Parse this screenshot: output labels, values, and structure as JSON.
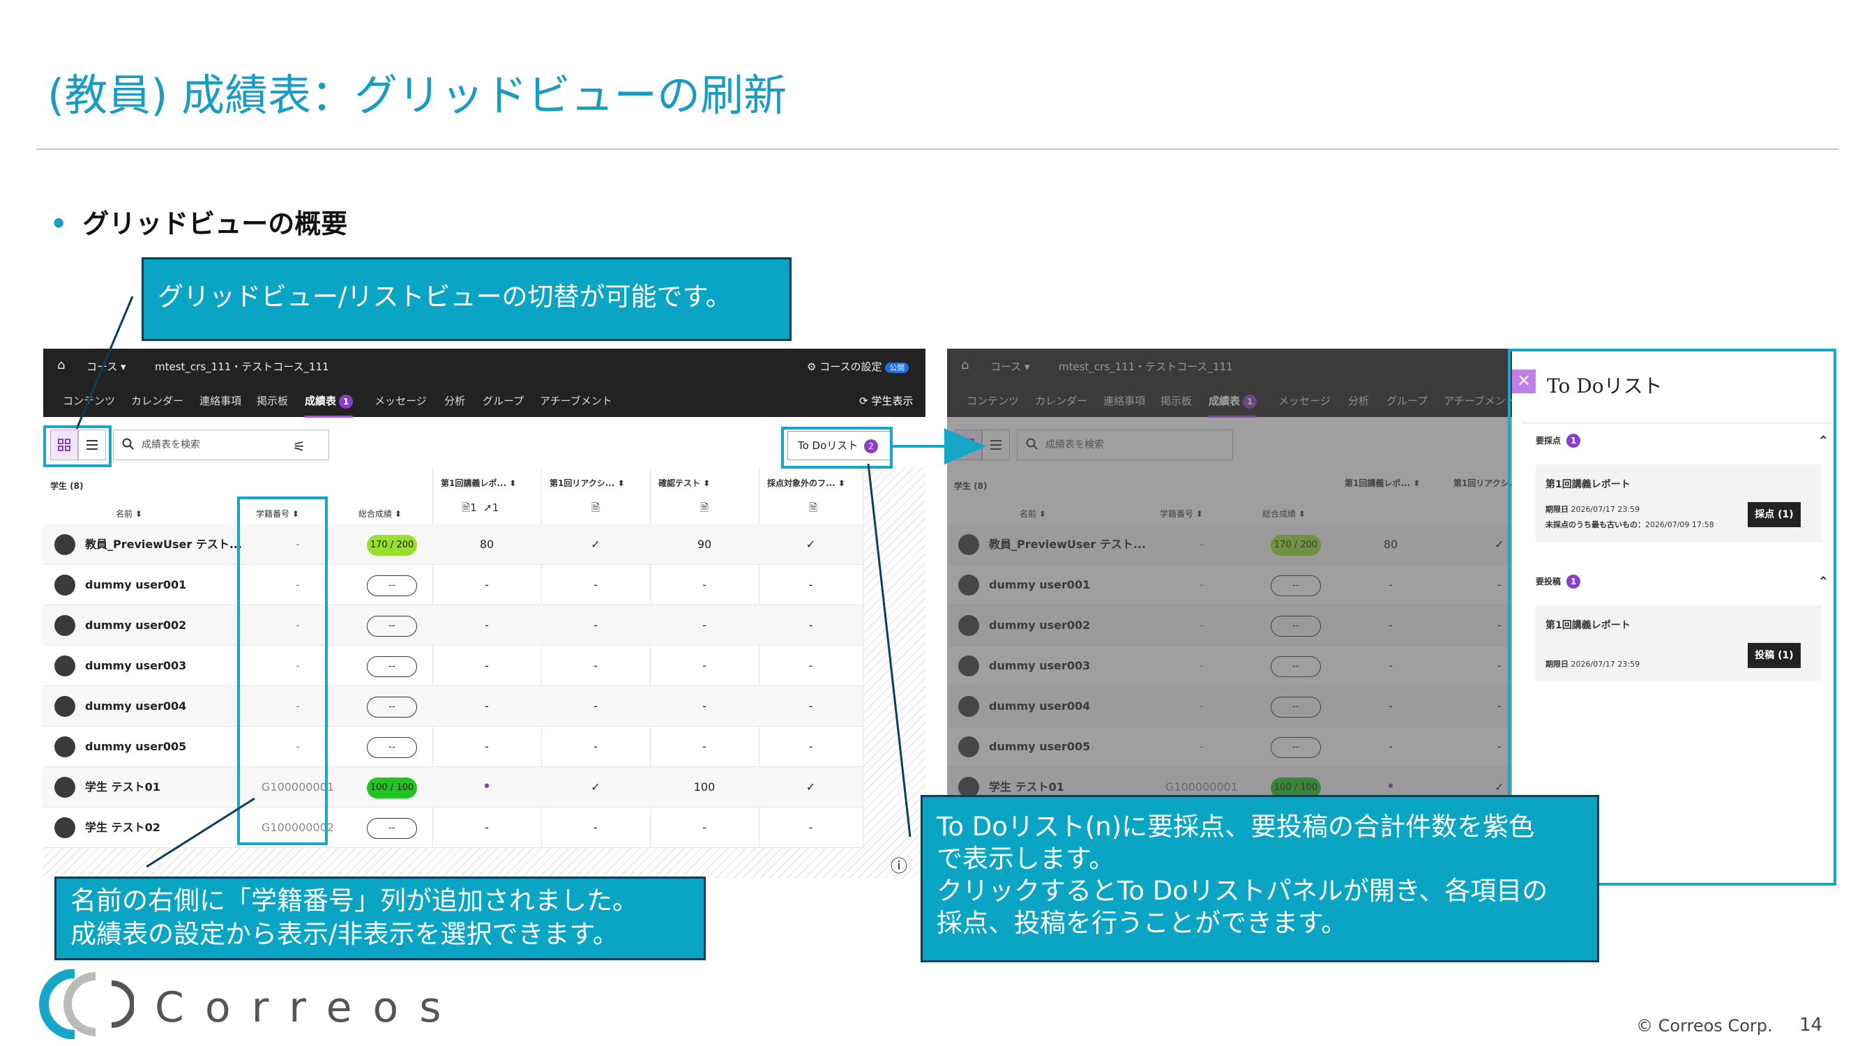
{
  "slide": {
    "title": "(教員) 成績表：グリッドビューの刷新",
    "bullet": "グリッドビューの概要",
    "callout_view": "グリッドビュー/リストビューの切替が可能です。",
    "callout_id_1": "名前の右側に「学籍番号」列が追加されました。",
    "callout_id_2": "成績表の設定から表示/非表示を選択できます。",
    "callout_todo_1": "To Doリスト(n)に要採点、要投稿の合計件数を紫色",
    "callout_todo_2": "で表示します。",
    "callout_todo_3": "クリックするとTo Doリストパネルが開き、各項目の",
    "callout_todo_4": "採点、投稿を行うことができます。",
    "logo": "Correos",
    "copyright": "© Correos Corp.",
    "page_number": "14",
    "accent_color": "#1a9bc4",
    "callout_color": "#0aa5c4",
    "badge_color": "#8b3fc9"
  },
  "app": {
    "breadcrumb_course": "コース",
    "course_name": "mtest_crs_111・テストコース_111",
    "course_settings": "コースの設定",
    "public_badge": "公開",
    "nav": [
      "コンテンツ",
      "カレンダー",
      "連絡事項",
      "掲示板",
      "成績表",
      "メッセージ",
      "分析",
      "グループ",
      "アチーブメント"
    ],
    "nav_badge": "1",
    "student_view": "学生表示",
    "search_placeholder": "成績表を検索",
    "todo_label": "To Doリスト",
    "todo_count": "2",
    "students_header": "学生 (8)",
    "col_name": "名前",
    "col_id": "学籍番号",
    "col_total": "総合成績",
    "col_items": [
      "第1回講義レポ...",
      "第1回リアクシ...",
      "確認テスト",
      "採点対象外のフ..."
    ],
    "col1_sub_a": "1",
    "col1_sub_b": "1",
    "rows": [
      {
        "name": "教員_PreviewUser テスト...",
        "id": "-",
        "total": "170 / 200",
        "c1": "80",
        "c2": "✓",
        "c3": "90",
        "c4": "✓"
      },
      {
        "name": "dummy user001",
        "id": "-",
        "total": "--",
        "c1": "-",
        "c2": "-",
        "c3": "-",
        "c4": "-"
      },
      {
        "name": "dummy user002",
        "id": "-",
        "total": "--",
        "c1": "-",
        "c2": "-",
        "c3": "-",
        "c4": "-"
      },
      {
        "name": "dummy user003",
        "id": "-",
        "total": "--",
        "c1": "-",
        "c2": "-",
        "c3": "-",
        "c4": "-"
      },
      {
        "name": "dummy user004",
        "id": "-",
        "total": "--",
        "c1": "-",
        "c2": "-",
        "c3": "-",
        "c4": "-"
      },
      {
        "name": "dummy user005",
        "id": "-",
        "total": "--",
        "c1": "-",
        "c2": "-",
        "c3": "-",
        "c4": "-"
      },
      {
        "name": "学生 テスト01",
        "id": "G100000001",
        "total": "100 / 100",
        "c1": "•",
        "c2": "✓",
        "c3": "100",
        "c4": "✓"
      },
      {
        "name": "学生 テスト02",
        "id": "G100000002",
        "total": "--",
        "c1": "-",
        "c2": "-",
        "c3": "-",
        "c4": "-"
      }
    ]
  },
  "todo_panel": {
    "title": "To Doリスト",
    "section_grade": "要採点",
    "section_grade_count": "1",
    "section_post": "要投稿",
    "section_post_count": "1",
    "grade_card_title": "第1回講義レポート",
    "grade_due_label": "期限日",
    "grade_due": "2026/07/17 23:59",
    "grade_oldest_label": "未採点のうち最も古いもの：",
    "grade_oldest": "2026/07/09 17:58",
    "grade_button": "採点 (1)",
    "post_card_title": "第1回講義レポート",
    "post_due_label": "期限日",
    "post_due": "2026/07/17 23:59",
    "post_button": "投稿 (1)"
  }
}
